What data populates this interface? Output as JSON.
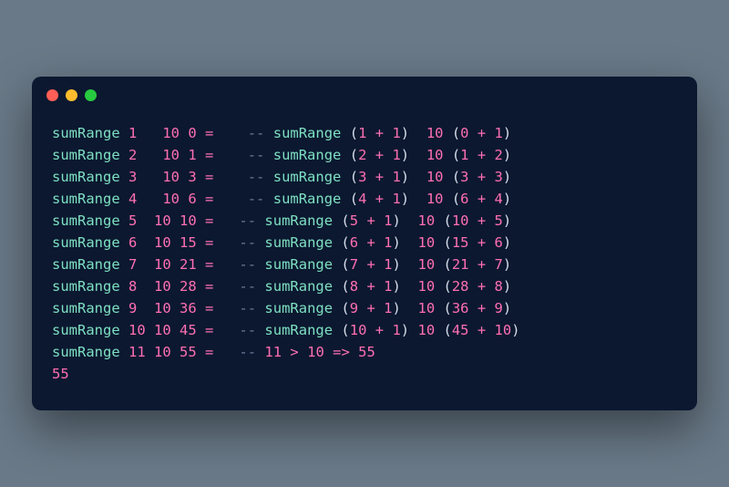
{
  "fn": "sumRange",
  "dash": "--",
  "gt": ">",
  "arrow": "=>",
  "rows": [
    {
      "a": "1",
      "b": "10",
      "c": "0",
      "pad1": "  ",
      "pad2": "    ",
      "r1": "1",
      "r2": "1",
      "sp": " ",
      "l1": "0",
      "l2": "1"
    },
    {
      "a": "2",
      "b": "10",
      "c": "1",
      "pad1": "  ",
      "pad2": "    ",
      "r1": "2",
      "r2": "1",
      "sp": " ",
      "l1": "1",
      "l2": "2"
    },
    {
      "a": "3",
      "b": "10",
      "c": "3",
      "pad1": "  ",
      "pad2": "    ",
      "r1": "3",
      "r2": "1",
      "sp": " ",
      "l1": "3",
      "l2": "3"
    },
    {
      "a": "4",
      "b": "10",
      "c": "6",
      "pad1": "  ",
      "pad2": "    ",
      "r1": "4",
      "r2": "1",
      "sp": " ",
      "l1": "6",
      "l2": "4"
    },
    {
      "a": "5",
      "b": "10",
      "c": "10",
      "pad1": " ",
      "pad2": "   ",
      "r1": "5",
      "r2": "1",
      "sp": " ",
      "l1": "10",
      "l2": "5"
    },
    {
      "a": "6",
      "b": "10",
      "c": "15",
      "pad1": " ",
      "pad2": "   ",
      "r1": "6",
      "r2": "1",
      "sp": " ",
      "l1": "15",
      "l2": "6"
    },
    {
      "a": "7",
      "b": "10",
      "c": "21",
      "pad1": " ",
      "pad2": "   ",
      "r1": "7",
      "r2": "1",
      "sp": " ",
      "l1": "21",
      "l2": "7"
    },
    {
      "a": "8",
      "b": "10",
      "c": "28",
      "pad1": " ",
      "pad2": "   ",
      "r1": "8",
      "r2": "1",
      "sp": " ",
      "l1": "28",
      "l2": "8"
    },
    {
      "a": "9",
      "b": "10",
      "c": "36",
      "pad1": " ",
      "pad2": "   ",
      "r1": "9",
      "r2": "1",
      "sp": " ",
      "l1": "36",
      "l2": "9"
    },
    {
      "a": "10",
      "b": "10",
      "c": "45",
      "pad1": "",
      "pad2": "   ",
      "r1": "10",
      "r2": "1",
      "sp": "",
      "l1": "45",
      "l2": "10"
    }
  ],
  "final": {
    "a": "11",
    "b": "10",
    "c": "55",
    "pad2": "   ",
    "cmpL": "11",
    "cmpR": "10",
    "res": "55"
  },
  "output": "55"
}
